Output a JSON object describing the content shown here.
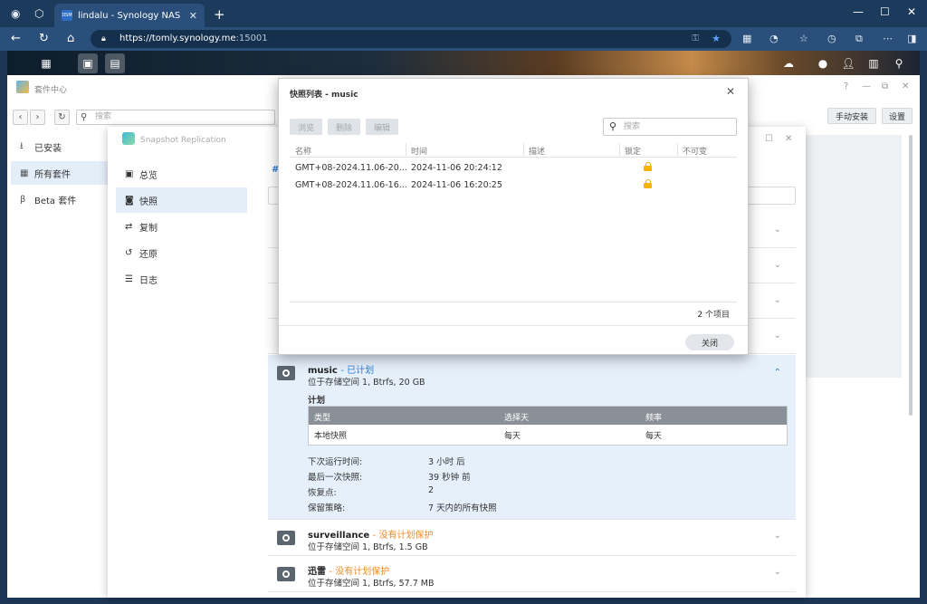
{
  "browser": {
    "tab_title": "lindalu - Synology NAS",
    "tab_favicon": "DSM",
    "url_host": "https://tomly.synology.me",
    "url_port": ":15001"
  },
  "package_center": {
    "title": "套件中心",
    "search_placeholder": "搜索",
    "manual_install": "手动安装",
    "settings": "设置",
    "sidebar": [
      {
        "label": "已安装",
        "icon": "download-icon"
      },
      {
        "label": "所有套件",
        "icon": "grid-icon"
      },
      {
        "label": "Beta 套件",
        "icon": "beta-icon"
      }
    ]
  },
  "snapshot": {
    "title": "Snapshot Replication",
    "nav": [
      {
        "label": "总览"
      },
      {
        "label": "快照"
      },
      {
        "label": "复制"
      },
      {
        "label": "还原"
      },
      {
        "label": "日志"
      }
    ],
    "partial_tab": "#",
    "music": {
      "name": "music",
      "status": "已计划",
      "location": "位于存储空间 1, Btrfs, 20 GB",
      "plan_label": "计划",
      "plan_headers": [
        "类型",
        "选择天",
        "频率"
      ],
      "plan_row": [
        "本地快照",
        "每天",
        "每天"
      ],
      "kv": [
        {
          "k": "下次运行时间:",
          "v": "3 小时 后"
        },
        {
          "k": "最后一次快照:",
          "v": "39 秒钟 前"
        },
        {
          "k": "恢复点:",
          "v": "2"
        },
        {
          "k": "保留策略:",
          "v": "7 天内的所有快照"
        }
      ]
    },
    "surveillance": {
      "name": "surveillance",
      "status": "没有计划保护",
      "location": "位于存储空间 1, Btrfs, 1.5 GB"
    },
    "xunlei": {
      "name": "迅雷",
      "status": "没有计划保护",
      "location": "位于存储空间 1, Btrfs, 57.7 MB"
    }
  },
  "modal": {
    "title": "快照列表 - music",
    "buttons": [
      "浏览",
      "删除",
      "编辑"
    ],
    "search_placeholder": "搜索",
    "headers": [
      "名称",
      "时间",
      "描述",
      "锁定",
      "不可变"
    ],
    "rows": [
      {
        "name": "GMT+08-2024.11.06-20...",
        "time": "2024-11-06 20:24:12",
        "locked": true
      },
      {
        "name": "GMT+08-2024.11.06-16...",
        "time": "2024-11-06 16:20:25",
        "locked": true
      }
    ],
    "count": "2 个项目",
    "close": "关闭"
  },
  "colors": {
    "accent_blue": "#2c7ed6",
    "warning_orange": "#f08a24",
    "lock_yellow": "#f4b400"
  }
}
